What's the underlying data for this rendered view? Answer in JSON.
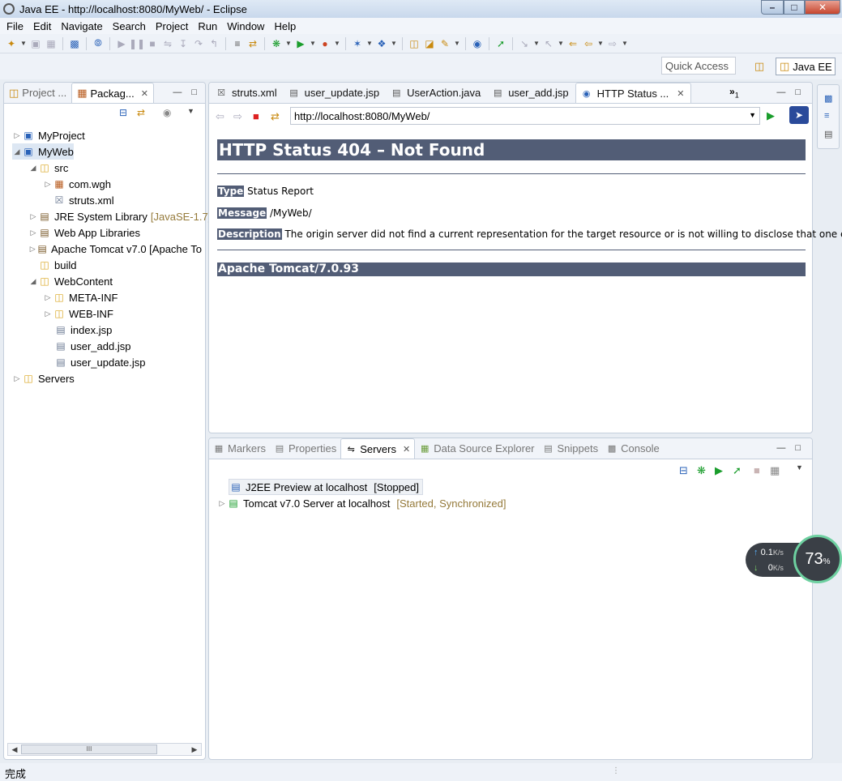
{
  "window": {
    "title": "Java EE - http://localhost:8080/MyWeb/ - Eclipse"
  },
  "menu": [
    "File",
    "Edit",
    "Navigate",
    "Search",
    "Project",
    "Run",
    "Window",
    "Help"
  ],
  "quick_access": {
    "placeholder": "Quick Access"
  },
  "perspective": {
    "label": "Java EE"
  },
  "left_panel": {
    "tabs": [
      {
        "label": "Project ..."
      },
      {
        "label": "Packag..."
      }
    ],
    "tree": [
      {
        "label": "MyProject",
        "decoration": ""
      },
      {
        "label": "MyWeb",
        "decoration": ""
      },
      {
        "label": "src",
        "decoration": ""
      },
      {
        "label": "com.wgh",
        "decoration": ""
      },
      {
        "label": "struts.xml",
        "decoration": ""
      },
      {
        "label": "JRE System Library",
        "decoration": "[JavaSE-1.7]"
      },
      {
        "label": "Web App Libraries",
        "decoration": ""
      },
      {
        "label": "Apache Tomcat v7.0 [Apache To",
        "decoration": ""
      },
      {
        "label": "build",
        "decoration": ""
      },
      {
        "label": "WebContent",
        "decoration": ""
      },
      {
        "label": "META-INF",
        "decoration": ""
      },
      {
        "label": "WEB-INF",
        "decoration": ""
      },
      {
        "label": "index.jsp",
        "decoration": ""
      },
      {
        "label": "user_add.jsp",
        "decoration": ""
      },
      {
        "label": "user_update.jsp",
        "decoration": ""
      },
      {
        "label": "Servers",
        "decoration": ""
      }
    ],
    "scroll_thumb": "III"
  },
  "editor": {
    "tabs": [
      {
        "label": "struts.xml"
      },
      {
        "label": "user_update.jsp"
      },
      {
        "label": "UserAction.java"
      },
      {
        "label": "user_add.jsp"
      },
      {
        "label": "HTTP Status ..."
      }
    ],
    "overflow": {
      "chevron": "»",
      "count": "1"
    },
    "url": "http://localhost:8080/MyWeb/",
    "page": {
      "heading": "HTTP Status 404 – Not Found",
      "rows": [
        {
          "label": "Type",
          "value": " Status Report"
        },
        {
          "label": "Message",
          "value": " /MyWeb/"
        },
        {
          "label": "Description",
          "value": " The origin server did not find a current representation for the target resource or is not willing to disclose that one exists."
        }
      ],
      "footer": "Apache Tomcat/7.0.93"
    }
  },
  "bottom_panel": {
    "tabs": [
      {
        "label": "Markers"
      },
      {
        "label": "Properties"
      },
      {
        "label": "Servers"
      },
      {
        "label": "Data Source Explorer"
      },
      {
        "label": "Snippets"
      },
      {
        "label": "Console"
      }
    ],
    "servers": [
      {
        "name": "J2EE Preview at localhost",
        "state": "[Stopped]"
      },
      {
        "name": "Tomcat v7.0 Server at localhost",
        "state": "[Started, Synchronized]"
      }
    ]
  },
  "net_widget": {
    "up": "0.1",
    "up_unit": "K/s",
    "down": "0",
    "down_unit": "K/s",
    "percent": "73",
    "percent_unit": "%"
  },
  "status_bar": {
    "text": "完成"
  }
}
